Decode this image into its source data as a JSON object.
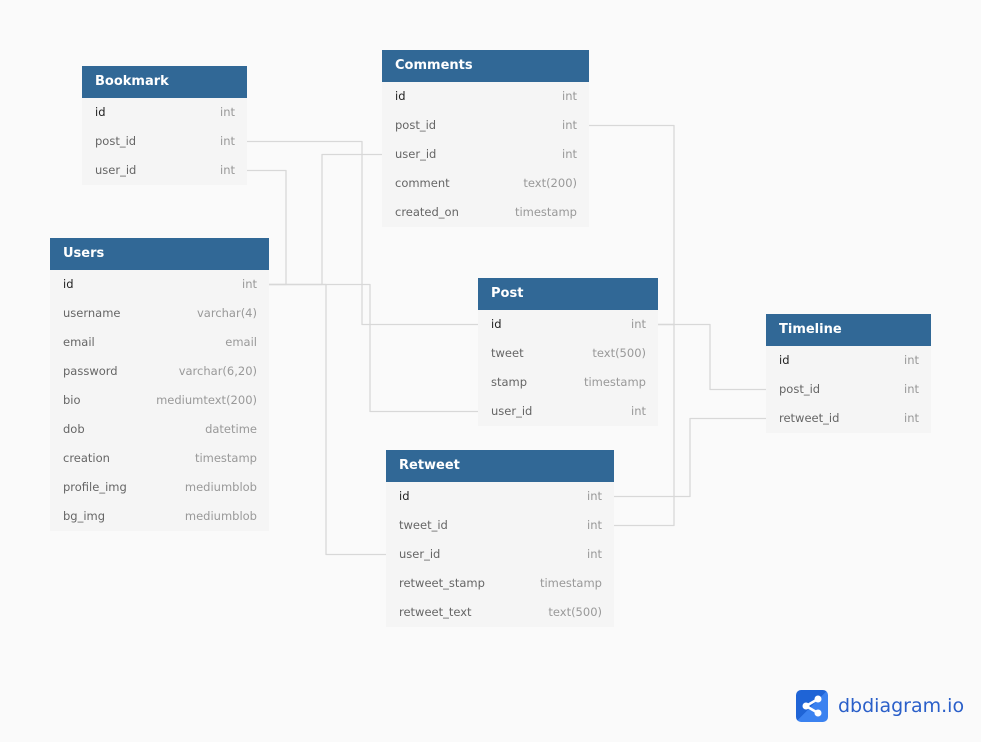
{
  "tables": [
    {
      "name": "Bookmark",
      "fields": [
        {
          "name": "id",
          "type": "int",
          "pk": true
        },
        {
          "name": "post_id",
          "type": "int"
        },
        {
          "name": "user_id",
          "type": "int"
        }
      ]
    },
    {
      "name": "Comments",
      "fields": [
        {
          "name": "id",
          "type": "int",
          "pk": true
        },
        {
          "name": "post_id",
          "type": "int"
        },
        {
          "name": "user_id",
          "type": "int"
        },
        {
          "name": "comment",
          "type": "text(200)"
        },
        {
          "name": "created_on",
          "type": "timestamp"
        }
      ]
    },
    {
      "name": "Users",
      "fields": [
        {
          "name": "id",
          "type": "int",
          "pk": true
        },
        {
          "name": "username",
          "type": "varchar(4)"
        },
        {
          "name": "email",
          "type": "email"
        },
        {
          "name": "password",
          "type": "varchar(6,20)"
        },
        {
          "name": "bio",
          "type": "mediumtext(200)"
        },
        {
          "name": "dob",
          "type": "datetime"
        },
        {
          "name": "creation",
          "type": "timestamp"
        },
        {
          "name": "profile_img",
          "type": "mediumblob"
        },
        {
          "name": "bg_img",
          "type": "mediumblob"
        }
      ]
    },
    {
      "name": "Post",
      "fields": [
        {
          "name": "id",
          "type": "int",
          "pk": true
        },
        {
          "name": "tweet",
          "type": "text(500)"
        },
        {
          "name": "stamp",
          "type": "timestamp"
        },
        {
          "name": "user_id",
          "type": "int"
        }
      ]
    },
    {
      "name": "Timeline",
      "fields": [
        {
          "name": "id",
          "type": "int",
          "pk": true
        },
        {
          "name": "post_id",
          "type": "int"
        },
        {
          "name": "retweet_id",
          "type": "int"
        }
      ]
    },
    {
      "name": "Retweet",
      "fields": [
        {
          "name": "id",
          "type": "int",
          "pk": true
        },
        {
          "name": "tweet_id",
          "type": "int"
        },
        {
          "name": "user_id",
          "type": "int"
        },
        {
          "name": "retweet_stamp",
          "type": "timestamp"
        },
        {
          "name": "retweet_text",
          "type": "text(500)"
        }
      ]
    }
  ],
  "relationships": [
    {
      "from": "Bookmark.post_id",
      "to": "Post.id"
    },
    {
      "from": "Bookmark.user_id",
      "to": "Users.id"
    },
    {
      "from": "Comments.post_id",
      "to": "Post.id"
    },
    {
      "from": "Comments.user_id",
      "to": "Users.id"
    },
    {
      "from": "Post.user_id",
      "to": "Users.id"
    },
    {
      "from": "Retweet.user_id",
      "to": "Users.id"
    },
    {
      "from": "Retweet.tweet_id",
      "to": "Post.id"
    },
    {
      "from": "Timeline.post_id",
      "to": "Post.id"
    },
    {
      "from": "Timeline.retweet_id",
      "to": "Retweet.id"
    }
  ],
  "branding": {
    "logo_text": "dbdiagram.io"
  },
  "colors": {
    "header": "#316896",
    "row_bg": "#f5f5f5",
    "link": "#d8d8d8",
    "logo": "#1f64d6"
  }
}
